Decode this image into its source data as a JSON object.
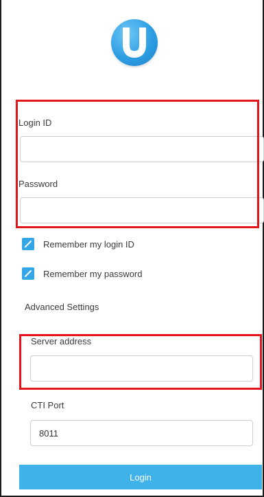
{
  "logo": {
    "icon": "u-logo-icon",
    "letter": "U",
    "color": "#2e9ee3"
  },
  "login": {
    "id_label": "Login ID",
    "id_value": "",
    "password_label": "Password",
    "password_value": ""
  },
  "options": {
    "remember_id_label": "Remember my login ID",
    "remember_id_checked": true,
    "remember_password_label": "Remember my password",
    "remember_password_checked": true
  },
  "advanced": {
    "heading": "Advanced Settings",
    "server_label": "Server address",
    "server_value": "",
    "port_label": "CTI Port",
    "port_value": "8011"
  },
  "actions": {
    "login_label": "Login"
  },
  "colors": {
    "accent": "#33a6e8",
    "button": "#3fb2ea",
    "highlight": "#e3141b"
  }
}
